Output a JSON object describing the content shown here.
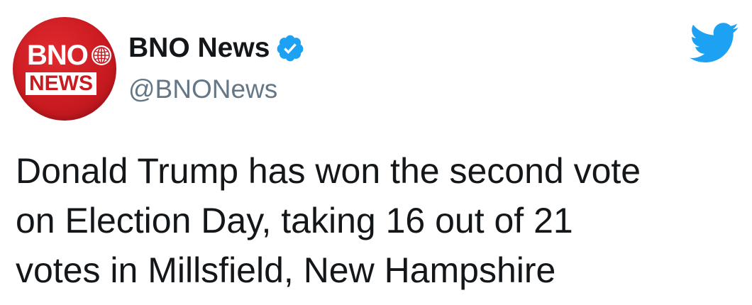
{
  "avatar": {
    "line1": "BNO",
    "line2": "NEWS",
    "brand_red": "#c81a20",
    "icon": "globe-icon"
  },
  "author": {
    "display_name": "BNO News",
    "handle": "@BNONews",
    "verified": true,
    "verified_icon": "verified-badge-icon",
    "verified_color": "#1da1f2"
  },
  "platform": {
    "icon": "twitter-bird-icon",
    "color": "#1da1f2"
  },
  "tweet": {
    "lines": [
      "Donald Trump has won the second vote",
      "on Election Day, taking 16 out of 21",
      "votes in Millsfield, New Hampshire"
    ]
  }
}
